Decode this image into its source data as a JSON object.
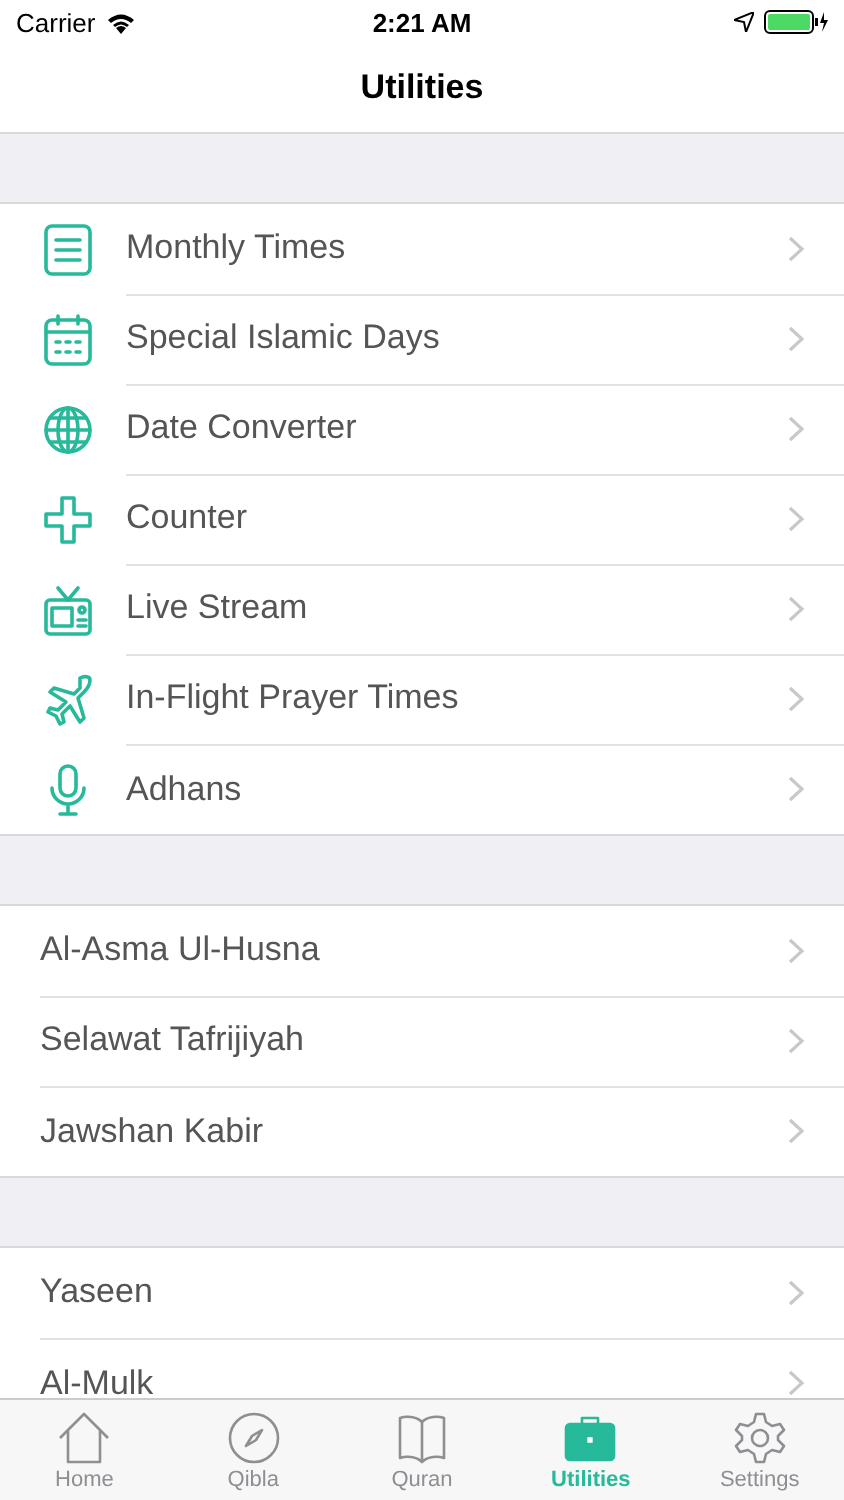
{
  "status_bar": {
    "carrier": "Carrier",
    "time": "2:21 AM"
  },
  "nav": {
    "title": "Utilities"
  },
  "sections": [
    {
      "items": [
        {
          "label": "Monthly Times",
          "kind": "list"
        },
        {
          "label": "Special Islamic Days",
          "kind": "calendar"
        },
        {
          "label": "Date Converter",
          "kind": "globe"
        },
        {
          "label": "Counter",
          "kind": "plus"
        },
        {
          "label": "Live Stream",
          "kind": "tv"
        },
        {
          "label": "In-Flight Prayer Times",
          "kind": "plane"
        },
        {
          "label": "Adhans",
          "kind": "mic"
        }
      ]
    },
    {
      "items": [
        {
          "label": "Al-Asma Ul-Husna"
        },
        {
          "label": "Selawat Tafrijiyah"
        },
        {
          "label": "Jawshan Kabir"
        }
      ]
    },
    {
      "items": [
        {
          "label": "Yaseen"
        },
        {
          "label": "Al-Mulk"
        }
      ]
    }
  ],
  "tab_bar": [
    {
      "label": "Home",
      "kind": "home",
      "selected": false
    },
    {
      "label": "Qibla",
      "kind": "compass",
      "selected": false
    },
    {
      "label": "Quran",
      "kind": "book",
      "selected": false
    },
    {
      "label": "Utilities",
      "kind": "briefcase",
      "selected": true
    },
    {
      "label": "Settings",
      "kind": "gear",
      "selected": false
    }
  ]
}
